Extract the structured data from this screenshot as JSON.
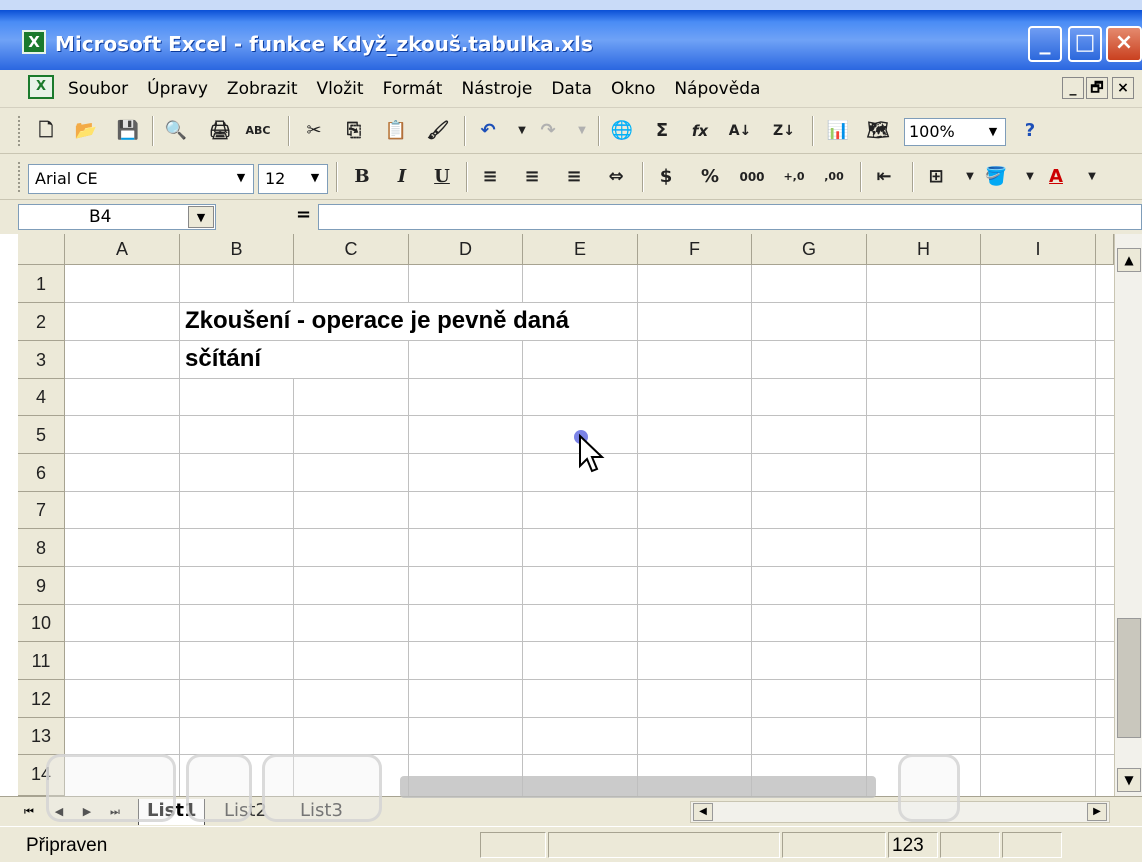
{
  "window": {
    "title": "Microsoft Excel - funkce Když_zkouš.tabulka.xls",
    "app_icon": "X",
    "min": "_",
    "max": "□",
    "close": "×"
  },
  "menu": {
    "doc_icon": "X",
    "items": [
      "Soubor",
      "Úpravy",
      "Zobrazit",
      "Vložit",
      "Formát",
      "Nástroje",
      "Data",
      "Okno",
      "Nápověda"
    ],
    "mdi": [
      "_",
      "🗗",
      "×"
    ]
  },
  "toolbar": {
    "standard": [
      "🗋",
      "📂",
      "💾",
      "🔍",
      "🖨",
      "ABC",
      "✂",
      "⎘",
      "📋",
      "🖌",
      "↶",
      "↷",
      "🌐",
      "Σ",
      "fx",
      "A↓",
      "Z↓",
      "📊",
      "🗺",
      "?"
    ],
    "zoom": "100%"
  },
  "formatting": {
    "font": "Arial CE",
    "size": "12",
    "buttons": [
      "B",
      "I",
      "U",
      "≡",
      "≡",
      "≡",
      "⇔",
      "$",
      "%",
      "000",
      "+,0",
      ",00",
      "⇤",
      "⊞",
      "🪣",
      "A"
    ]
  },
  "formula_bar": {
    "name_box": "B4",
    "equals": "="
  },
  "grid": {
    "columns": [
      "A",
      "B",
      "C",
      "D",
      "E",
      "F",
      "G",
      "H",
      "I"
    ],
    "rows": [
      "1",
      "2",
      "3",
      "4",
      "5",
      "6",
      "7",
      "8",
      "9",
      "10",
      "11",
      "12",
      "13",
      "14"
    ],
    "cells": {
      "B2": "Zkoušení - operace je pevně daná",
      "B3": "sčítání"
    }
  },
  "sheets": {
    "tabs": [
      "List1",
      "List2",
      "List3"
    ],
    "active": "List1"
  },
  "status": {
    "text": "Připraven",
    "num": "123"
  },
  "icons": {
    "first-sheet": "⏮",
    "prev-sheet": "◀",
    "next-sheet": "▶",
    "last-sheet": "⏭",
    "scroll-up": "▲",
    "scroll-down": "▼",
    "scroll-left": "◀",
    "scroll-right": "▶",
    "dropdown": "▼"
  },
  "colors": {
    "title_bar": "#2a66e0",
    "chrome": "#ece9d8",
    "grid_line": "#c0c0c0",
    "click_marker": "#7b83e6"
  }
}
